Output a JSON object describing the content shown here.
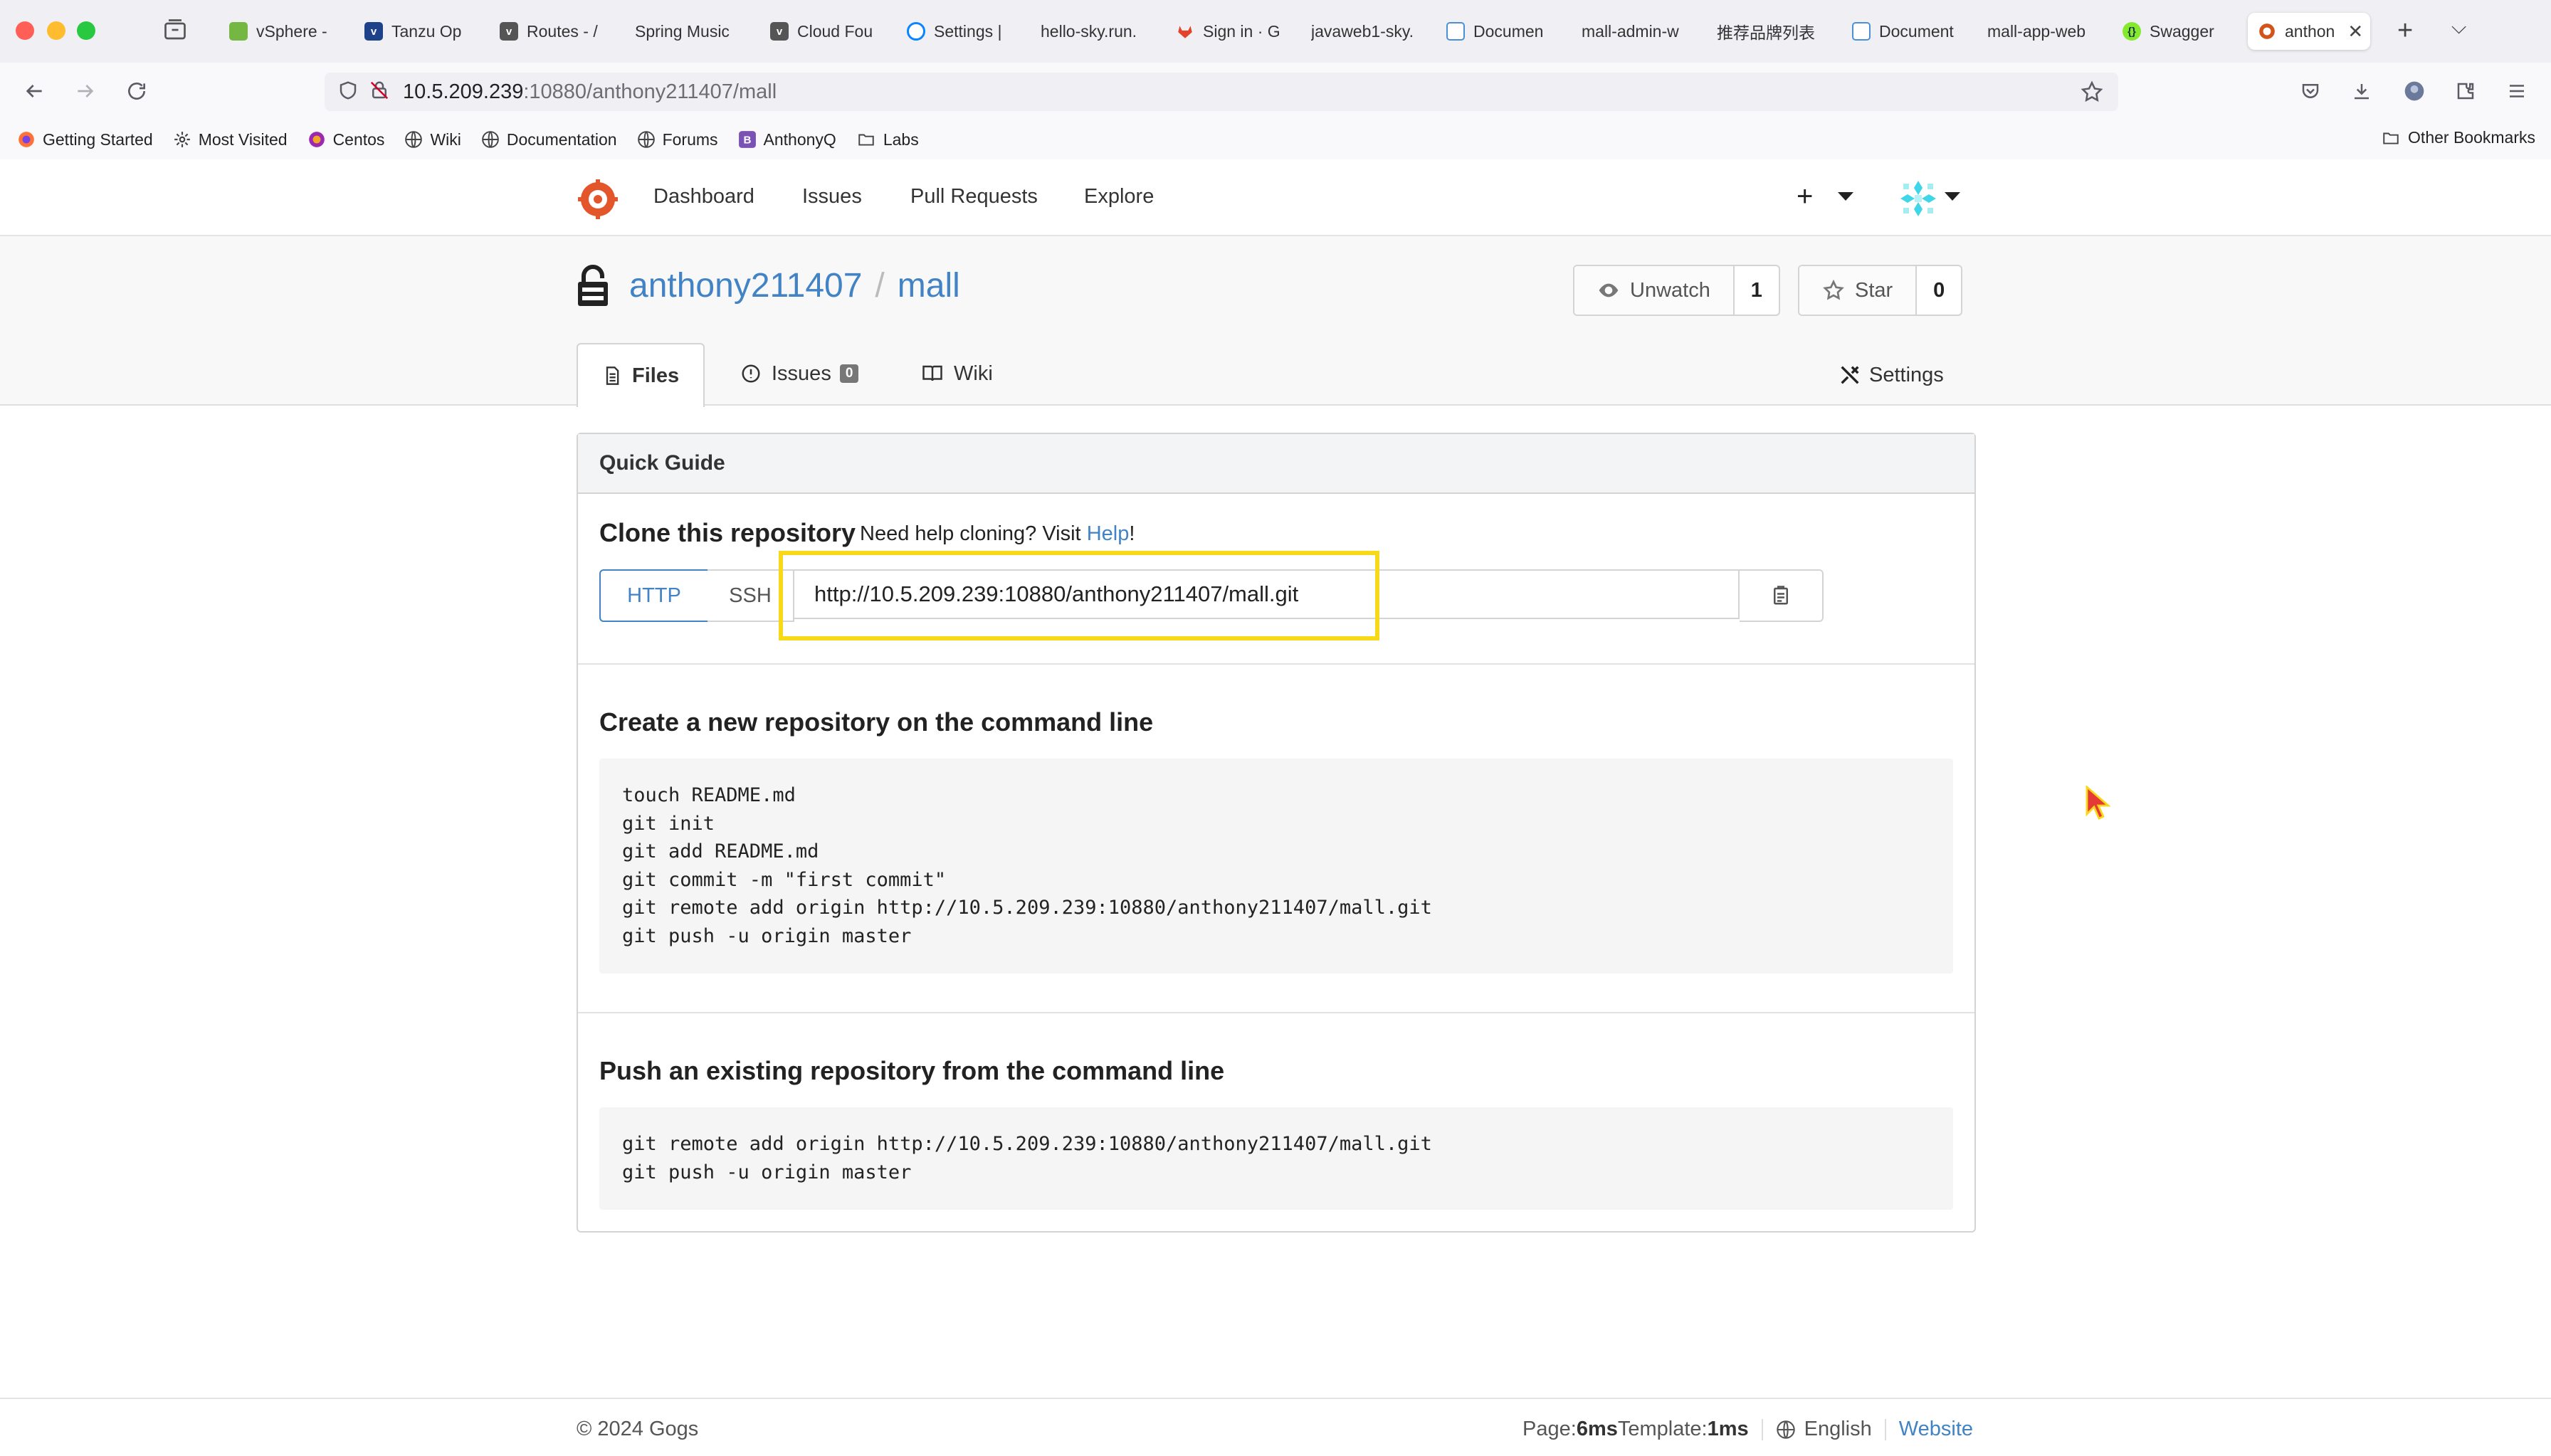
{
  "browser": {
    "tabs": [
      {
        "label": "vSphere -",
        "icon": "vsphere-icon",
        "color": "#74b843"
      },
      {
        "label": "Tanzu Op",
        "icon": "vmware-icon",
        "color": "#1d428a"
      },
      {
        "label": "Routes - /",
        "icon": "vmware-icon",
        "color": "#555555"
      },
      {
        "label": "Spring Music",
        "icon": "",
        "color": ""
      },
      {
        "label": "Cloud Fou",
        "icon": "vmware-icon",
        "color": "#555555"
      },
      {
        "label": "Settings |",
        "icon": "settings-circle-icon",
        "color": "#0a84ff"
      },
      {
        "label": "hello-sky.run.",
        "icon": "",
        "color": ""
      },
      {
        "label": "Sign in · G",
        "icon": "gitlab-icon",
        "color": "#e24329"
      },
      {
        "label": "javaweb1-sky.",
        "icon": "",
        "color": ""
      },
      {
        "label": "Documen",
        "icon": "document-icon",
        "color": "#4a90d9"
      },
      {
        "label": "mall-admin-w",
        "icon": "",
        "color": ""
      },
      {
        "label": "推荐品牌列表",
        "icon": "",
        "color": ""
      },
      {
        "label": "Document",
        "icon": "document-icon",
        "color": "#4a90d9"
      },
      {
        "label": "mall-app-web",
        "icon": "",
        "color": ""
      },
      {
        "label": "Swagger",
        "icon": "swagger-icon",
        "color": "#85ea2d"
      },
      {
        "label": "anthon",
        "icon": "gogs-icon",
        "color": "#d3541a"
      }
    ],
    "url": {
      "host": "10.5.209.239",
      "rest": ":10880/anthony211407/mall"
    },
    "bookmarks": [
      {
        "label": "Getting Started",
        "icon": "firefox-icon"
      },
      {
        "label": "Most Visited",
        "icon": "gear-icon"
      },
      {
        "label": "Centos",
        "icon": "centos-icon"
      },
      {
        "label": "Wiki",
        "icon": "globe-icon"
      },
      {
        "label": "Documentation",
        "icon": "globe-icon"
      },
      {
        "label": "Forums",
        "icon": "globe-icon"
      },
      {
        "label": "AnthonyQ",
        "icon": "bootstrap-icon"
      },
      {
        "label": "Labs",
        "icon": "folder-icon"
      }
    ],
    "other_bookmarks": "Other Bookmarks"
  },
  "gogs": {
    "nav": {
      "dashboard": "Dashboard",
      "issues": "Issues",
      "pulls": "Pull Requests",
      "explore": "Explore",
      "plus": "+"
    },
    "repo": {
      "owner": "anthony211407",
      "separator": "/",
      "name": "mall"
    },
    "watch": {
      "label": "Unwatch",
      "count": "1"
    },
    "star": {
      "label": "Star",
      "count": "0"
    },
    "tabs": {
      "files": "Files",
      "issues": "Issues",
      "issues_count": "0",
      "wiki": "Wiki",
      "settings": "Settings"
    },
    "guide": {
      "title": "Quick Guide",
      "clone_title": "Clone this repository",
      "clone_help_prefix": "Need help cloning? Visit ",
      "clone_help_link": "Help",
      "clone_help_suffix": "!",
      "http": "HTTP",
      "ssh": "SSH",
      "clone_url": "http://10.5.209.239:10880/anthony211407/mall.git",
      "new_title": "Create a new repository on the command line",
      "new_code": [
        "touch README.md",
        "git init",
        "git add README.md",
        "git commit -m \"first commit\"",
        "git remote add origin http://10.5.209.239:10880/anthony211407/mall.git",
        "git push -u origin master"
      ],
      "push_title": "Push an existing repository from the command line",
      "push_code": [
        "git remote add origin http://10.5.209.239:10880/anthony211407/mall.git",
        "git push -u origin master"
      ]
    },
    "footer": {
      "copyright": "© 2024 Gogs",
      "page_label": "Page: ",
      "page_time": "6ms",
      "template_label": " Template: ",
      "template_time": "1ms",
      "language": "English",
      "website": "Website"
    }
  },
  "colors": {
    "link": "#4183c4",
    "highlight": "#f7d91a",
    "gogs_brand": "#e3562b"
  }
}
